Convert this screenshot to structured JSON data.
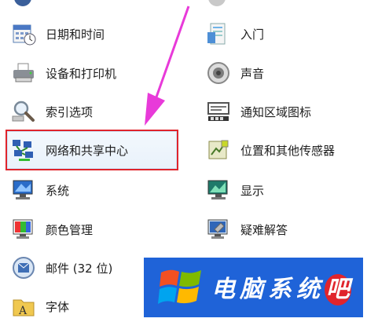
{
  "control_panel": {
    "left_items": [
      {
        "label": "日期和时间",
        "icon": "calendar-clock-icon"
      },
      {
        "label": "设备和打印机",
        "icon": "printer-icon"
      },
      {
        "label": "索引选项",
        "icon": "magnifier-icon"
      },
      {
        "label": "网络和共享中心",
        "icon": "network-icon"
      },
      {
        "label": "系统",
        "icon": "computer-icon"
      },
      {
        "label": "颜色管理",
        "icon": "color-management-icon"
      },
      {
        "label": "邮件 (32 位)",
        "icon": "mail-icon"
      },
      {
        "label": "字体",
        "icon": "font-folder-icon"
      }
    ],
    "right_items": [
      {
        "label": "入门",
        "icon": "getting-started-icon"
      },
      {
        "label": "声音",
        "icon": "speaker-icon"
      },
      {
        "label": "通知区域图标",
        "icon": "notification-tray-icon"
      },
      {
        "label": "位置和其他传感器",
        "icon": "sensor-icon"
      },
      {
        "label": "显示",
        "icon": "display-icon"
      },
      {
        "label": "疑难解答",
        "icon": "troubleshooting-icon"
      }
    ]
  },
  "banner": {
    "brand_text": "电脑系统",
    "brand_last": "吧",
    "logo_icon": "windows-logo-icon"
  },
  "colors": {
    "highlight_border": "#e0242c",
    "arrow": "#e83ad9",
    "banner_bg": "#1f63d8"
  }
}
